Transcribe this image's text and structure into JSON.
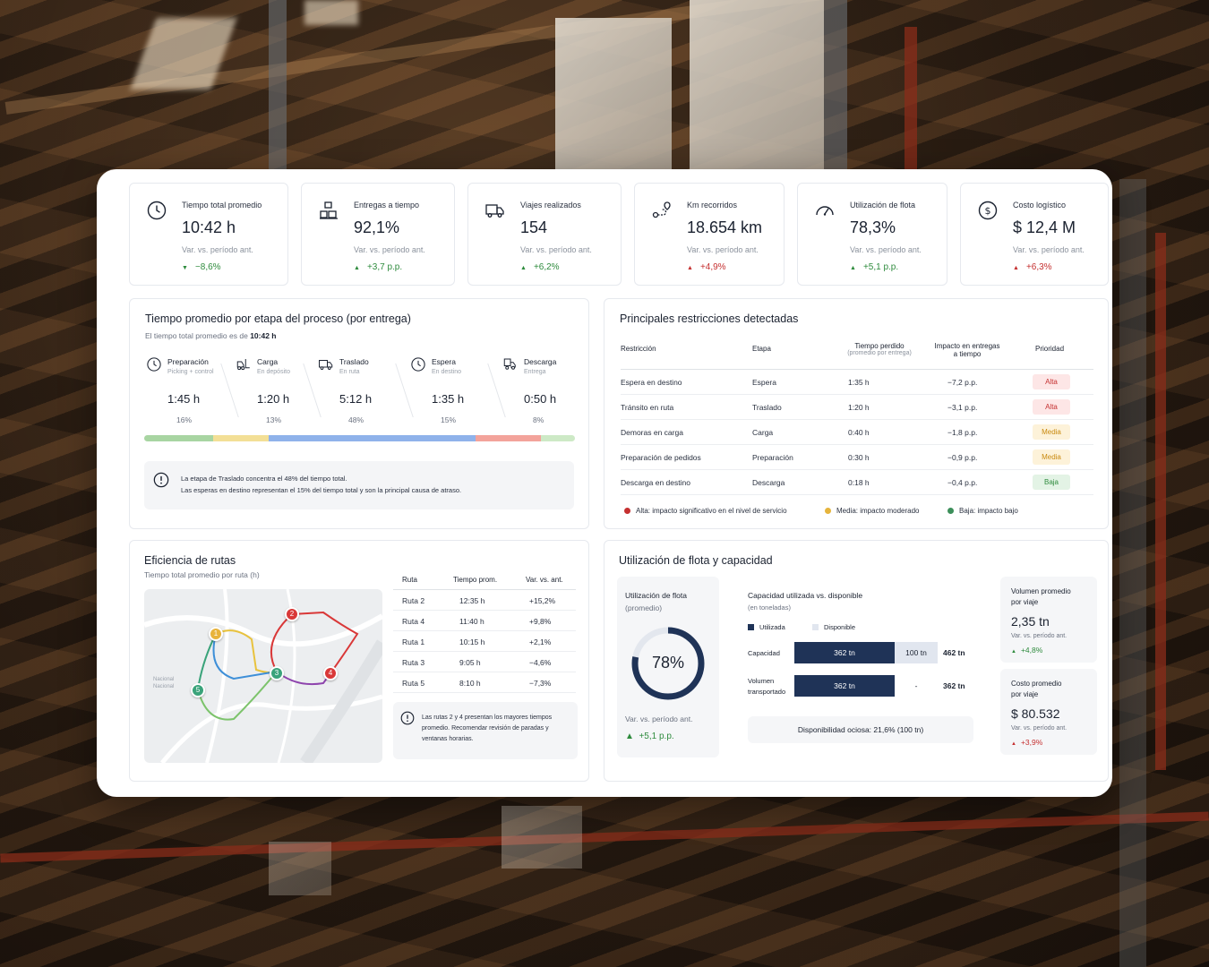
{
  "kpis": [
    {
      "label": "Tiempo total promedio",
      "value": "10:42 h",
      "var_label": "Var. vs. período ant.",
      "change": "−8,6%",
      "icon": "clock-icon"
    },
    {
      "label": "Entregas a tiempo",
      "value": "92,1%",
      "var_label": "Var. vs. período ant.",
      "change": "+3,7 p.p.",
      "icon": "boxes-icon"
    },
    {
      "label": "Viajes realizados",
      "value": "154",
      "var_label": "Var. vs. período ant.",
      "change": "+6,2%",
      "icon": "truck-icon"
    },
    {
      "label": "Km recorridos",
      "value": "18.654 km",
      "var_label": "Var. vs. período ant.",
      "change": "+4,9%",
      "icon": "route-icon"
    },
    {
      "label": "Utilización de flota",
      "value": "78,3%",
      "var_label": "Var. vs. período ant.",
      "change": "+5,1 p.p.",
      "icon": "gauge-icon"
    },
    {
      "label": "Costo logístico",
      "value": "$ 12,4 M",
      "var_label": "Var. vs. período ant.",
      "change": "+6,3%",
      "icon": "dollar-icon"
    }
  ],
  "stages_panel": {
    "title": "Tiempo promedio por etapa del proceso (por entrega)",
    "subtitle_prefix": "El tiempo total promedio es de",
    "subtitle_value": "10:42 h",
    "stages": [
      {
        "name": "Preparación",
        "desc": "Picking + control",
        "time": "1:45 h",
        "pct": "16%",
        "share": 16,
        "color": "#a8d5a2",
        "icon": "clock-icon"
      },
      {
        "name": "Carga",
        "desc": "En depósito",
        "time": "1:20 h",
        "pct": "13%",
        "share": 13,
        "color": "#f3df96",
        "icon": "forklift-icon"
      },
      {
        "name": "Traslado",
        "desc": "En ruta",
        "time": "5:12 h",
        "pct": "48%",
        "share": 48,
        "color": "#8fb2ea",
        "icon": "truck-icon"
      },
      {
        "name": "Espera",
        "desc": "En destino",
        "time": "1:35 h",
        "pct": "15%",
        "share": 15,
        "color": "#f3a39b",
        "icon": "clock-icon"
      },
      {
        "name": "Descarga",
        "desc": "Entrega",
        "time": "0:50 h",
        "pct": "8%",
        "share": 8,
        "color": "#cde9c6",
        "icon": "unload-icon"
      }
    ],
    "note_line1": "La etapa de Traslado concentra el 48% del tiempo total.",
    "note_line2": "Las esperas en destino representan el 15% del tiempo total y son la principal causa de atraso."
  },
  "restrictions": {
    "title": "Principales restricciones detectadas",
    "headers": {
      "restriccion": "Restricción",
      "etapa": "Etapa",
      "tiempo": "Tiempo perdido",
      "tiempo_sub": "(promedio por entrega)",
      "impacto_1": "Impacto en entregas",
      "impacto_2": "a tiempo",
      "prioridad": "Prioridad"
    },
    "rows": [
      {
        "restriccion": "Espera en destino",
        "etapa": "Espera",
        "tiempo": "1:35 h",
        "impacto": "−7,2 p.p.",
        "prioridad": "Alta",
        "level": "alta"
      },
      {
        "restriccion": "Tránsito en ruta",
        "etapa": "Traslado",
        "tiempo": "1:20 h",
        "impacto": "−3,1 p.p.",
        "prioridad": "Alta",
        "level": "alta"
      },
      {
        "restriccion": "Demoras en carga",
        "etapa": "Carga",
        "tiempo": "0:40 h",
        "impacto": "−1,8 p.p.",
        "prioridad": "Media",
        "level": "media"
      },
      {
        "restriccion": "Preparación de pedidos",
        "etapa": "Preparación",
        "tiempo": "0:30 h",
        "impacto": "−0,9 p.p.",
        "prioridad": "Media",
        "level": "media"
      },
      {
        "restriccion": "Descarga en destino",
        "etapa": "Descarga",
        "tiempo": "0:18 h",
        "impacto": "−0,4 p.p.",
        "prioridad": "Baja",
        "level": "baja"
      }
    ],
    "legend": [
      {
        "text": "Alta: impacto significativo en el nivel de servicio",
        "color": "#c53030"
      },
      {
        "text": "Media: impacto moderado",
        "color": "#e6b43c"
      },
      {
        "text": "Baja: impacto bajo",
        "color": "#3c8f5a"
      }
    ]
  },
  "routes": {
    "title": "Eficiencia de rutas",
    "subtitle": "Tiempo total promedio por ruta (h)",
    "map_label_1": "Nacional",
    "map_label_2": "Nacional",
    "markers": [
      "1",
      "2",
      "3",
      "4",
      "5"
    ],
    "headers": {
      "ruta": "Ruta",
      "tiempo": "Tiempo prom.",
      "var": "Var. vs. ant."
    },
    "rows": [
      {
        "ruta": "Ruta 2",
        "tiempo": "12:35 h",
        "var": "+15,2%",
        "cls": "red"
      },
      {
        "ruta": "Ruta 4",
        "tiempo": "11:40 h",
        "var": "+9,8%",
        "cls": "red"
      },
      {
        "ruta": "Ruta 1",
        "tiempo": "10:15 h",
        "var": "+2,1%",
        "cls": "orange"
      },
      {
        "ruta": "Ruta 3",
        "tiempo": "9:05 h",
        "var": "−4,6%",
        "cls": "green"
      },
      {
        "ruta": "Ruta 5",
        "tiempo": "8:10 h",
        "var": "−7,3%",
        "cls": "green"
      }
    ],
    "note_line1": "Las rutas 2 y 4 presentan los mayores tiempos",
    "note_line2": "promedio. Recomendar revisión de paradas y",
    "note_line3": "ventanas horarias."
  },
  "fleet": {
    "title": "Utilización de flota y capacidad",
    "util_label": "Utilización de flota",
    "util_sub": "(promedio)",
    "util_value": "78%",
    "util_fraction": 0.78,
    "util_var_label": "Var. vs. período ant.",
    "util_change": "+5,1 p.p.",
    "capacity_title": "Capacidad utilizada vs. disponible",
    "capacity_sub": "(en toneladas)",
    "legend_used": "Utilizada",
    "legend_avail": "Disponible",
    "rows": [
      {
        "label_1": "Capacidad",
        "label_2": "",
        "used": "362 tn",
        "avail": "100 tn",
        "total": "462 tn"
      },
      {
        "label_1": "Volumen",
        "label_2": "transportado",
        "used": "362 tn",
        "avail": "-",
        "total": "362 tn"
      }
    ],
    "idle": "Disponibilidad ociosa: 21,6% (100 tn)",
    "side": [
      {
        "label_1": "Volumen promedio",
        "label_2": "por viaje",
        "value": "2,35 tn",
        "var_label": "Var. vs. período ant.",
        "change": "+4,8%"
      },
      {
        "label_1": "Costo promedio",
        "label_2": "por viaje",
        "value": "$ 80.532",
        "var_label": "Var. vs. período ant.",
        "change": "+3,9%"
      }
    ]
  },
  "colors": {
    "navy": "#1f3357",
    "green": "#2e8b3d",
    "red": "#c53030",
    "orange": "#d98a1b"
  }
}
